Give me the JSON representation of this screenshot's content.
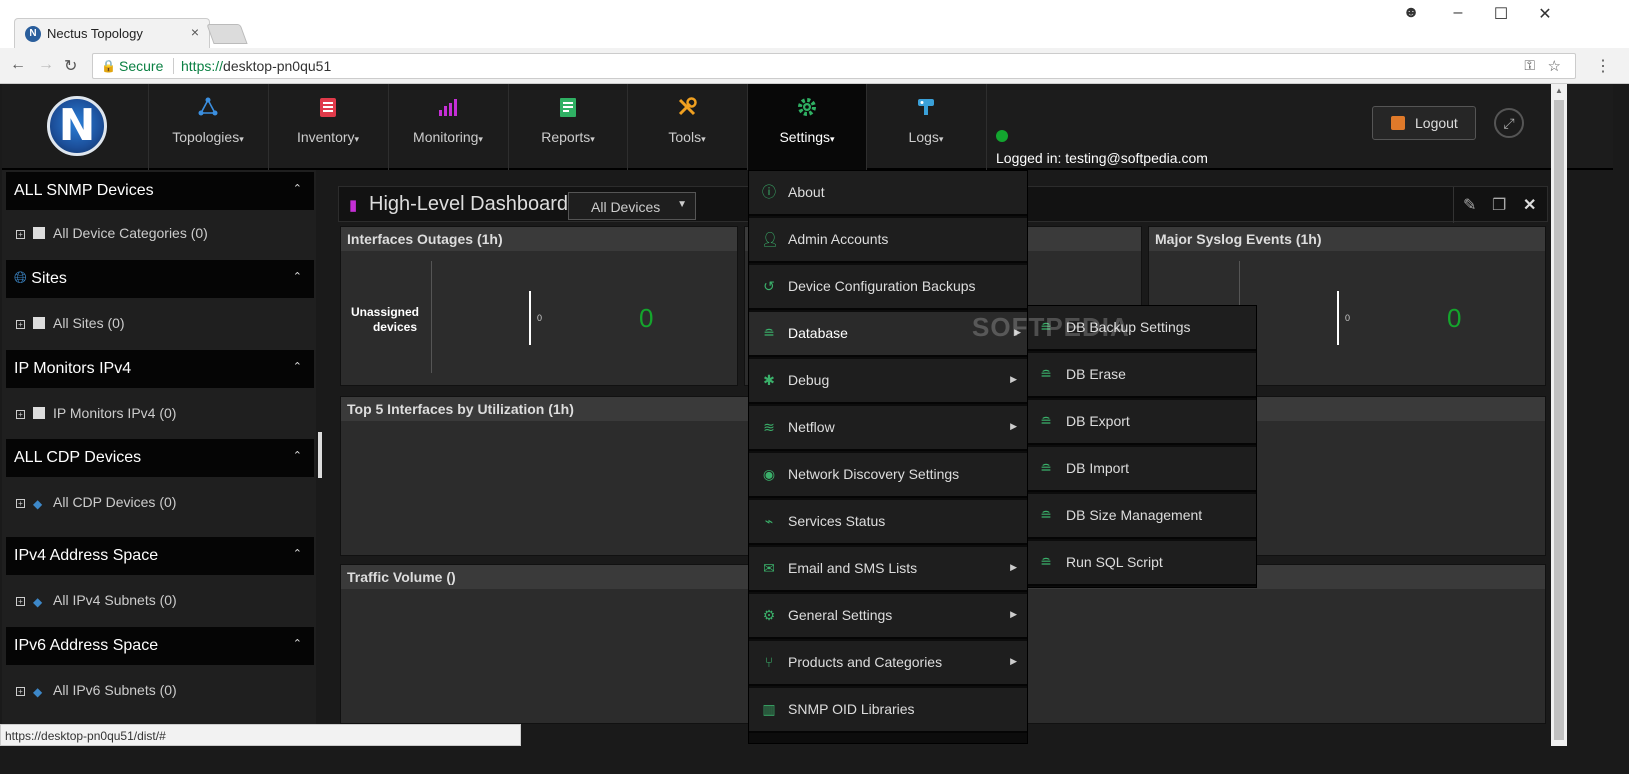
{
  "browser": {
    "tab_title": "Nectus Topology",
    "tab_close": "×",
    "secure_label": "Secure",
    "url_scheme": "https://",
    "url_host": "desktop-pn0qu51",
    "status_url": "https://desktop-pn0qu51/dist/#"
  },
  "nav": {
    "logo_letter": "N",
    "items": [
      {
        "label": "Topologies",
        "icon": "topology-icon"
      },
      {
        "label": "Inventory",
        "icon": "inventory-icon"
      },
      {
        "label": "Monitoring",
        "icon": "monitoring-icon"
      },
      {
        "label": "Reports",
        "icon": "reports-icon"
      },
      {
        "label": "Tools",
        "icon": "tools-icon"
      },
      {
        "label": "Settings",
        "icon": "gear-icon"
      },
      {
        "label": "Logs",
        "icon": "logs-icon"
      }
    ],
    "caret": "▾",
    "logged_in": "Logged in: testing@softpedia.com",
    "logout_label": "Logout"
  },
  "sidebar": {
    "sections": [
      {
        "title": "ALL SNMP Devices",
        "item": "All Device Categories (0)"
      },
      {
        "title": "Sites",
        "item": "All Sites (0)"
      },
      {
        "title": "IP Monitors IPv4",
        "item": "IP Monitors IPv4 (0)"
      },
      {
        "title": "ALL CDP Devices",
        "item": "All CDP Devices (0)"
      },
      {
        "title": "IPv4 Address Space",
        "item": "All IPv4 Subnets (0)"
      },
      {
        "title": "IPv6 Address Space",
        "item": "All IPv6 Subnets (0)"
      }
    ]
  },
  "dashboard": {
    "title": "High-Level Dashboard",
    "filter_value": "All Devices",
    "widgets": {
      "interfaces_outages": "Interfaces Outages (1h)",
      "major_syslog": "Major Syslog Events (1h)",
      "top5": "Top 5 Interfaces by Utilization (1h)",
      "traffic": "Traffic Volume ()"
    },
    "unassigned_label": "Unassigned devices",
    "axis_zero": "0",
    "count_zero": "0"
  },
  "settings_menu": {
    "items": [
      {
        "label": "About",
        "icon": "info-icon",
        "submenu": false
      },
      {
        "label": "Admin Accounts",
        "icon": "user-icon",
        "submenu": false
      },
      {
        "label": "Device Configuration Backups",
        "icon": "history-icon",
        "submenu": false
      },
      {
        "label": "Database",
        "icon": "database-icon",
        "submenu": true
      },
      {
        "label": "Debug",
        "icon": "bug-icon",
        "submenu": true
      },
      {
        "label": "Netflow",
        "icon": "netflow-icon",
        "submenu": true
      },
      {
        "label": "Network Discovery Settings",
        "icon": "eye-icon",
        "submenu": false
      },
      {
        "label": "Services Status",
        "icon": "pulse-icon",
        "submenu": false
      },
      {
        "label": "Email and SMS Lists",
        "icon": "envelope-icon",
        "submenu": true
      },
      {
        "label": "General Settings",
        "icon": "gear-icon",
        "submenu": true
      },
      {
        "label": "Products and Categories",
        "icon": "branch-icon",
        "submenu": true
      },
      {
        "label": "SNMP OID Libraries",
        "icon": "book-icon",
        "submenu": false
      }
    ]
  },
  "database_menu": {
    "items": [
      {
        "label": "DB Backup Settings",
        "icon": "db-settings-icon"
      },
      {
        "label": "DB Erase",
        "icon": "db-erase-icon"
      },
      {
        "label": "DB Export",
        "icon": "db-export-icon"
      },
      {
        "label": "DB Import",
        "icon": "db-import-icon"
      },
      {
        "label": "DB Size Management",
        "icon": "db-size-icon"
      },
      {
        "label": "Run SQL Script",
        "icon": "db-sql-icon"
      }
    ]
  },
  "watermark": "SOFTPEDIA",
  "colors": {
    "accent_green": "#3ab06a",
    "status_green": "#13a52f",
    "dashboard_icon": "#c52fd6"
  }
}
